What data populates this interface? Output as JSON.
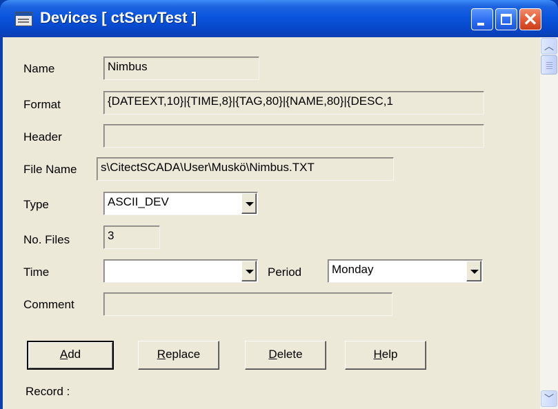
{
  "window": {
    "title": "Devices [ ctServTest ]",
    "icon": "app-form-icon",
    "controls": [
      "minimize-icon",
      "maximize-icon",
      "close-icon"
    ]
  },
  "form": {
    "name": {
      "label": "Name",
      "value": "Nimbus"
    },
    "format": {
      "label": "Format",
      "value": "{DATEEXT,10}|{TIME,8}|{TAG,80}|{NAME,80}|{DESC,1"
    },
    "header": {
      "label": "Header",
      "value": ""
    },
    "file_name": {
      "label": "File Name",
      "value": "s\\CitectSCADA\\User\\Muskö\\Nimbus.TXT"
    },
    "type": {
      "label": "Type",
      "value": "ASCII_DEV"
    },
    "no_files": {
      "label": "No. Files",
      "value": "3"
    },
    "time": {
      "label": "Time",
      "value": ""
    },
    "period": {
      "label": "Period",
      "value": "Monday"
    },
    "comment": {
      "label": "Comment",
      "value": ""
    }
  },
  "buttons": {
    "add": {
      "mnemonic": "A",
      "rest": "dd"
    },
    "replace": {
      "mnemonic": "R",
      "rest": "eplace"
    },
    "delete": {
      "mnemonic": "D",
      "rest": "elete"
    },
    "help": {
      "mnemonic": "H",
      "rest": "elp"
    }
  },
  "status": {
    "record": "Record :"
  },
  "colors": {
    "titlebar": "#0a55de",
    "dialog_bg": "#ece9d8",
    "close_button": "#e2542c"
  }
}
